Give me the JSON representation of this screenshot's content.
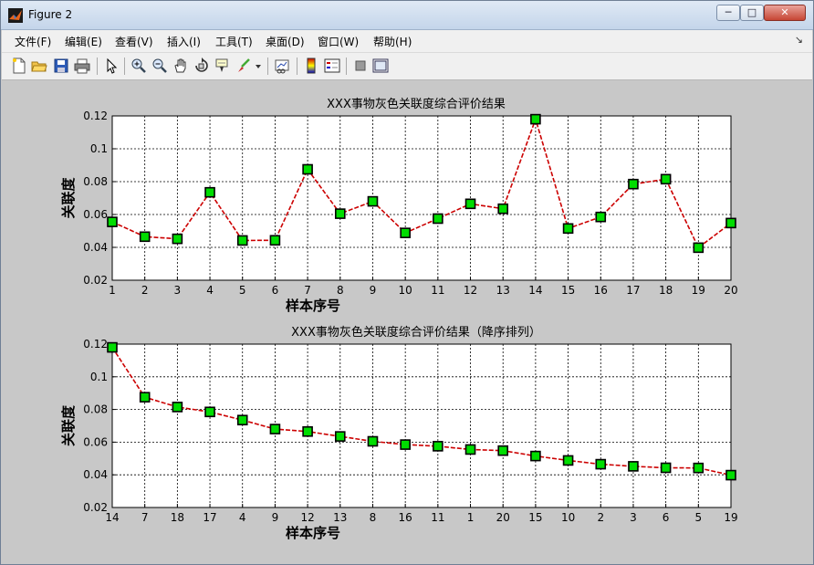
{
  "window": {
    "title": "Figure 2",
    "min_label": "─",
    "max_label": "□",
    "close_label": "✕"
  },
  "menu": [
    {
      "label": "文件(F)"
    },
    {
      "label": "编辑(E)"
    },
    {
      "label": "查看(V)"
    },
    {
      "label": "插入(I)"
    },
    {
      "label": "工具(T)"
    },
    {
      "label": "桌面(D)"
    },
    {
      "label": "窗口(W)"
    },
    {
      "label": "帮助(H)"
    }
  ],
  "menu_arrow": "↘",
  "toolbar_icons": [
    "new-figure-icon",
    "open-file-icon",
    "save-icon",
    "print-icon",
    "pointer-icon",
    "zoom-in-icon",
    "zoom-out-icon",
    "pan-hand-icon",
    "rotate-3d-icon",
    "data-cursor-icon",
    "brush-icon",
    "brush-dropdown-icon",
    "link-plot-icon",
    "colorbar-icon",
    "legend-icon",
    "hide-plot-tools-icon",
    "show-plot-tools-icon"
  ],
  "colors": {
    "line": "#cc0000",
    "marker_fill": "#00dd00",
    "marker_edge": "#000000",
    "axes_bg": "#ffffff",
    "figure_bg": "#c8c8c8"
  },
  "chart_data": [
    {
      "type": "line",
      "title": "XXX事物灰色关联度综合评价结果",
      "xlabel": "样本序号",
      "ylabel": "关联度",
      "categories": [
        "1",
        "2",
        "3",
        "4",
        "5",
        "6",
        "7",
        "8",
        "9",
        "10",
        "11",
        "12",
        "13",
        "14",
        "15",
        "16",
        "17",
        "18",
        "19",
        "20"
      ],
      "values": [
        0.0555,
        0.0465,
        0.0452,
        0.0735,
        0.0442,
        0.0443,
        0.0875,
        0.0605,
        0.068,
        0.0488,
        0.0575,
        0.0665,
        0.0635,
        0.118,
        0.0515,
        0.0585,
        0.0785,
        0.0815,
        0.0398,
        0.0548
      ],
      "ylim": [
        0.02,
        0.12
      ],
      "yticks": [
        "0.02",
        "0.04",
        "0.06",
        "0.08",
        "0.1",
        "0.12"
      ],
      "grid": true
    },
    {
      "type": "line",
      "title": "XXX事物灰色关联度综合评价结果（降序排列）",
      "xlabel": "样本序号",
      "ylabel": "关联度",
      "categories": [
        "14",
        "7",
        "18",
        "17",
        "4",
        "9",
        "12",
        "13",
        "8",
        "16",
        "11",
        "1",
        "20",
        "15",
        "10",
        "2",
        "3",
        "6",
        "5",
        "19"
      ],
      "values": [
        0.118,
        0.0875,
        0.0815,
        0.0785,
        0.0735,
        0.068,
        0.0665,
        0.0635,
        0.0605,
        0.0585,
        0.0575,
        0.0555,
        0.0548,
        0.0515,
        0.0488,
        0.0465,
        0.0452,
        0.0443,
        0.0442,
        0.0398
      ],
      "ylim": [
        0.02,
        0.12
      ],
      "yticks": [
        "0.02",
        "0.04",
        "0.06",
        "0.08",
        "0.1",
        "0.12"
      ],
      "grid": true
    }
  ]
}
